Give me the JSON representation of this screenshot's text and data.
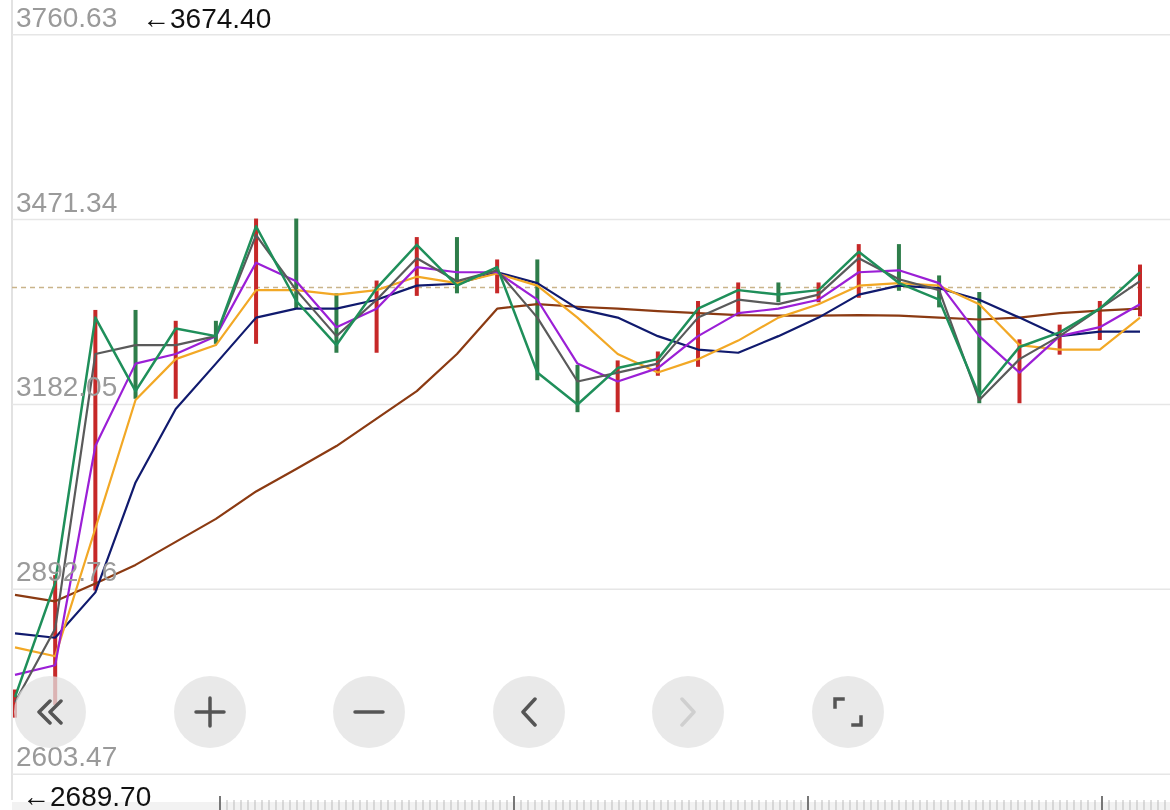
{
  "chart_data": {
    "type": "line",
    "grid": true,
    "ylim": [
      2560,
      3815
    ],
    "yticks": [
      {
        "value": 3760.63,
        "label": "3760.63"
      },
      {
        "value": 3471.34,
        "label": "3471.34"
      },
      {
        "value": 3182.05,
        "label": "3182.05"
      },
      {
        "value": 2892.76,
        "label": "2892.76"
      },
      {
        "value": 2603.47,
        "label": "2603.47"
      }
    ],
    "series": [
      {
        "color": "#1f8f5a",
        "values": [
          2724,
          2903,
          3318,
          3203,
          3301,
          3289,
          3461,
          3344,
          3275,
          3364,
          3432,
          3368,
          3397,
          3232,
          3182,
          3239,
          3253,
          3332,
          3361,
          3354,
          3361,
          3421,
          3372,
          3346,
          3196,
          3272,
          3295,
          3332,
          3389
        ]
      },
      {
        "color": "#5a5a5a",
        "values": [
          2716,
          2831,
          3261,
          3275,
          3275,
          3289,
          3447,
          3361,
          3289,
          3346,
          3411,
          3375,
          3392,
          3318,
          3218,
          3232,
          3246,
          3318,
          3346,
          3339,
          3354,
          3411,
          3378,
          3361,
          3189,
          3253,
          3289,
          3332,
          3375
        ]
      },
      {
        "color": "#9b1fd6",
        "values": [
          2759,
          2774,
          3117,
          3246,
          3261,
          3289,
          3404,
          3375,
          3303,
          3332,
          3397,
          3389,
          3389,
          3346,
          3246,
          3218,
          3239,
          3289,
          3325,
          3332,
          3346,
          3389,
          3392,
          3372,
          3289,
          3232,
          3289,
          3303,
          3339
        ]
      },
      {
        "color": "#f2a825",
        "values": [
          2802,
          2788,
          2988,
          3189,
          3253,
          3275,
          3361,
          3361,
          3354,
          3361,
          3382,
          3372,
          3387,
          3368,
          3318,
          3261,
          3232,
          3253,
          3282,
          3318,
          3339,
          3368,
          3372,
          3368,
          3339,
          3275,
          3268,
          3268,
          3318
        ]
      },
      {
        "color": "#101a6e",
        "values": [
          2824,
          2817,
          2888,
          3060,
          3175,
          3246,
          3318,
          3332,
          3332,
          3346,
          3368,
          3371,
          3389,
          3372,
          3332,
          3318,
          3289,
          3268,
          3263,
          3289,
          3318,
          3354,
          3368,
          3364,
          3346,
          3318,
          3289,
          3296,
          3296
        ]
      },
      {
        "color": "#8b3a12",
        "values": [
          2884,
          2874,
          2902,
          2931,
          2967,
          3003,
          3046,
          3081,
          3117,
          3160,
          3203,
          3261,
          3332,
          3339,
          3335,
          3332,
          3328,
          3325,
          3322,
          3321,
          3321,
          3322,
          3321,
          3318,
          3315,
          3318,
          3325,
          3329,
          3332
        ]
      }
    ],
    "annotations": [
      "←3674.40",
      "←2689.70"
    ],
    "ref_lines": [
      {
        "axis": "y",
        "value": 3365
      }
    ]
  },
  "controls": [
    {
      "kind": "rewind",
      "disabled": false
    },
    {
      "kind": "zoom_in",
      "disabled": false
    },
    {
      "kind": "zoom_out",
      "disabled": false
    },
    {
      "kind": "back",
      "disabled": false
    },
    {
      "kind": "forward",
      "disabled": true
    },
    {
      "kind": "fullscreen",
      "disabled": false
    }
  ]
}
